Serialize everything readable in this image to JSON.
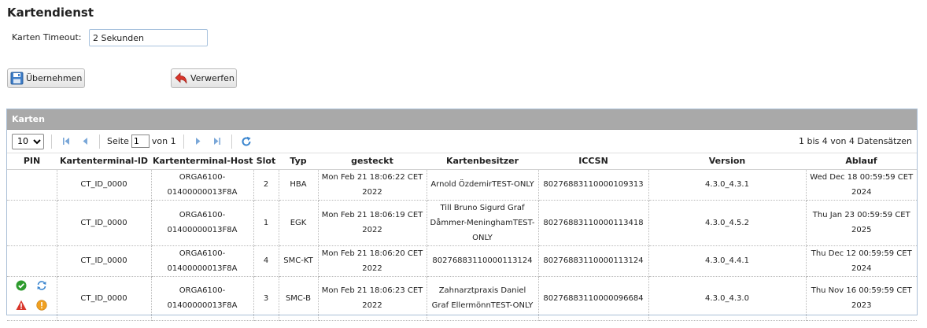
{
  "page": {
    "title": "Kartendienst"
  },
  "settings": {
    "timeout_label": "Karten Timeout:",
    "timeout_value": "2 Sekunden"
  },
  "buttons": {
    "save_label": "Übernehmen",
    "discard_label": "Verwerfen"
  },
  "panel": {
    "title": "Karten",
    "pager": {
      "page_size": "10",
      "page_label": "Seite",
      "current_page": "1",
      "of_label": "von 1",
      "records_text": "1 bis 4 von 4 Datensätzen"
    },
    "columns": [
      "PIN",
      "Kartenterminal-ID",
      "Kartenterminal-Host",
      "Slot",
      "Typ",
      "gesteckt",
      "Kartenbesitzer",
      "ICCSN",
      "Version",
      "Ablauf"
    ],
    "rows": [
      {
        "terminal_id": "CT_ID_0000",
        "host": "ORGA6100-01400000013F8A",
        "slot": "2",
        "typ": "HBA",
        "gesteckt": "Mon Feb 21 18:06:22 CET 2022",
        "besitzer": "Arnold ÖzdemirTEST-ONLY",
        "iccsn": "80276883110000109313",
        "version": "4.3.0_4.3.1",
        "ablauf": "Wed Dec 18 00:59:59 CET 2024"
      },
      {
        "terminal_id": "CT_ID_0000",
        "host": "ORGA6100-01400000013F8A",
        "slot": "1",
        "typ": "EGK",
        "gesteckt": "Mon Feb 21 18:06:19 CET 2022",
        "besitzer": "Till Bruno Sigurd Graf Dåmmer-MeninghamTEST-ONLY",
        "iccsn": "80276883110000113418",
        "version": "4.3.0_4.5.2",
        "ablauf": "Thu Jan 23 00:59:59 CET 2025"
      },
      {
        "terminal_id": "CT_ID_0000",
        "host": "ORGA6100-01400000013F8A",
        "slot": "4",
        "typ": "SMC-KT",
        "gesteckt": "Mon Feb 21 18:06:20 CET 2022",
        "besitzer": "80276883110000113124",
        "iccsn": "80276883110000113124",
        "version": "4.3.0_4.4.1",
        "ablauf": "Thu Dec 12 00:59:59 CET 2024"
      },
      {
        "terminal_id": "CT_ID_0000",
        "host": "ORGA6100-01400000013F8A",
        "slot": "3",
        "typ": "SMC-B",
        "gesteckt": "Mon Feb 21 18:06:23 CET 2022",
        "besitzer": "Zahnarztpraxis Daniel Graf EllermönnTEST-ONLY",
        "iccsn": "80276883110000096684",
        "version": "4.3.0_4.3.0",
        "ablauf": "Thu Nov 16 00:59:59 CET 2023"
      }
    ]
  },
  "icons": {
    "save": "floppy-disk-icon",
    "discard": "undo-arrow-icon",
    "first": "first-page-icon",
    "prev": "prev-page-icon",
    "next": "next-page-icon",
    "last": "last-page-icon",
    "refresh": "refresh-icon",
    "pin_ok": "green-check-icon",
    "pin_sync": "sync-icon",
    "pin_warn": "warning-triangle-icon",
    "pin_info": "exclamation-circle-icon"
  },
  "colors": {
    "panel_header": "#a9a9a9",
    "nav_blue": "#3b86cf",
    "ok_green": "#2e9b2e",
    "warn_red": "#d9362b",
    "info_orange": "#f0a020"
  }
}
